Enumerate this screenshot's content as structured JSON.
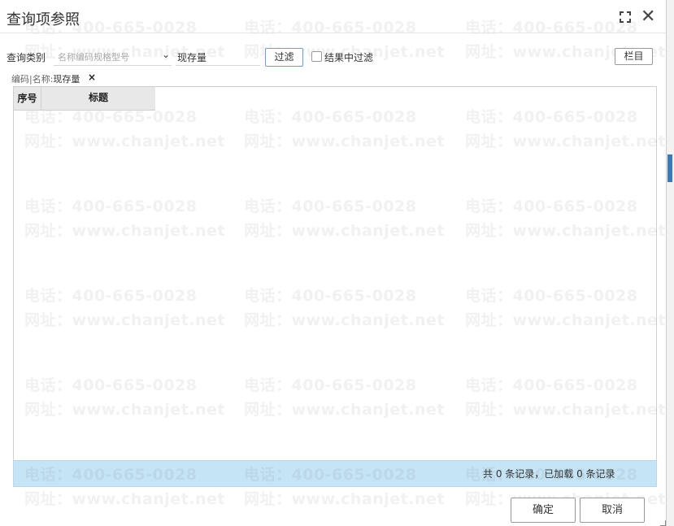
{
  "dialog": {
    "title": "查询项参照",
    "maximize_icon": "maximize-icon",
    "close_icon": "close-icon",
    "close_glyph": "✕"
  },
  "filter_bar": {
    "category_label": "查询类别",
    "category_select_value": "名称编码规格型号",
    "category_chevron": "⌄",
    "keyword_value": "现存量",
    "filter_button": "过滤",
    "filter_in_results_label": "结果中过滤",
    "filter_in_results_checked": false,
    "columns_button": "栏目"
  },
  "breadcrumb": {
    "prefix": "编码|名称:",
    "value": "现存量",
    "remove_glyph": "×"
  },
  "table": {
    "columns": [
      "序号",
      "标题"
    ],
    "rows": []
  },
  "status": {
    "text": "共 0 条记录，已加载 0 条记录"
  },
  "footer": {
    "ok_button": "确定",
    "cancel_button": "取消"
  },
  "watermark": {
    "phone": "电话：400-665-0028",
    "site": "网址：www.chanjet.net"
  },
  "colors": {
    "status_bar": "#c5e4f5",
    "filter_button_border": "#6a9fd4",
    "grid_header": "#e8e8e8"
  }
}
